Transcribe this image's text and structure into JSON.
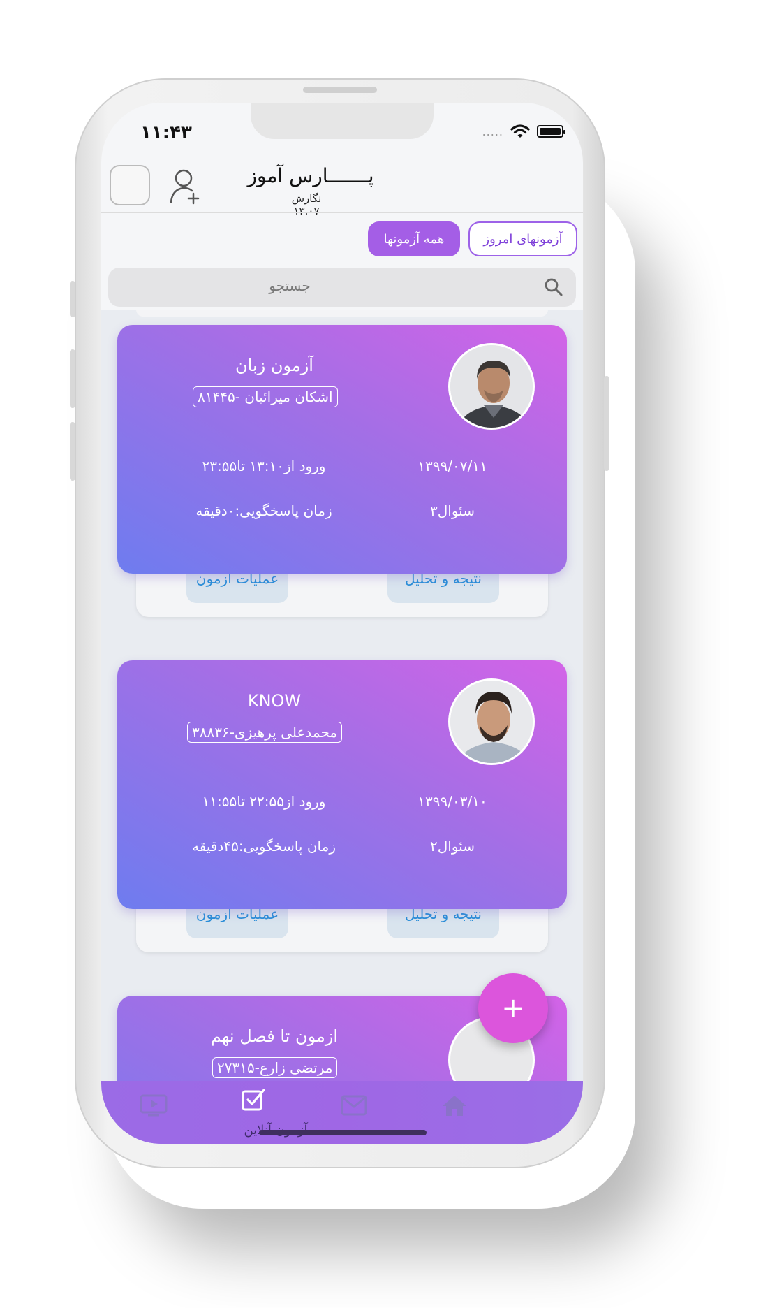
{
  "status_bar": {
    "time": "۱۱:۴۳",
    "signal_dots": "....."
  },
  "header": {
    "title": "پـــــــارس آموز",
    "subtitle": "نگارش ۱۳.۰۷"
  },
  "tabs": [
    {
      "label": "آزمونهای امروز",
      "active": false
    },
    {
      "label": "همه آزمونها",
      "active": true
    }
  ],
  "search": {
    "placeholder": "جستجو"
  },
  "exams": [
    {
      "title": "آزمون زبان",
      "teacher": "اشکان  میرائیان -۸۱۴۴۵",
      "entry": "ورود از۱۳:۱۰ تا۲۳:۵۵",
      "date": "۱۳۹۹/۰۷/۱۱",
      "duration": "زمان پاسخگویی:۰دقیقه",
      "questions": "۳سئوال",
      "actions": {
        "result": "نتیجه و تحلیل",
        "operations": "عملیات آزمون"
      }
    },
    {
      "title": "KNOW",
      "teacher": "محمدعلی پرهیزی-۳۸۸۳۶",
      "entry": "ورود از۲۲:۵۵ تا۱۱:۵۵",
      "date": "۱۳۹۹/۰۳/۱۰",
      "duration": "زمان پاسخگویی:۴۵دقیقه",
      "questions": "۲سئوال",
      "actions": {
        "result": "نتیجه و تحلیل",
        "operations": "عملیات آزمون"
      }
    },
    {
      "title": "ازمون تا فصل نهم",
      "teacher": "مرتضی زارع-۲۷۳۱۵"
    }
  ],
  "fab": {
    "label": "+"
  },
  "bottom_nav": {
    "active_label": "آزمون آنلاین"
  },
  "colors": {
    "accent": "#a45ee6",
    "fab": "#dc55dc",
    "link": "#2a8fd8"
  }
}
